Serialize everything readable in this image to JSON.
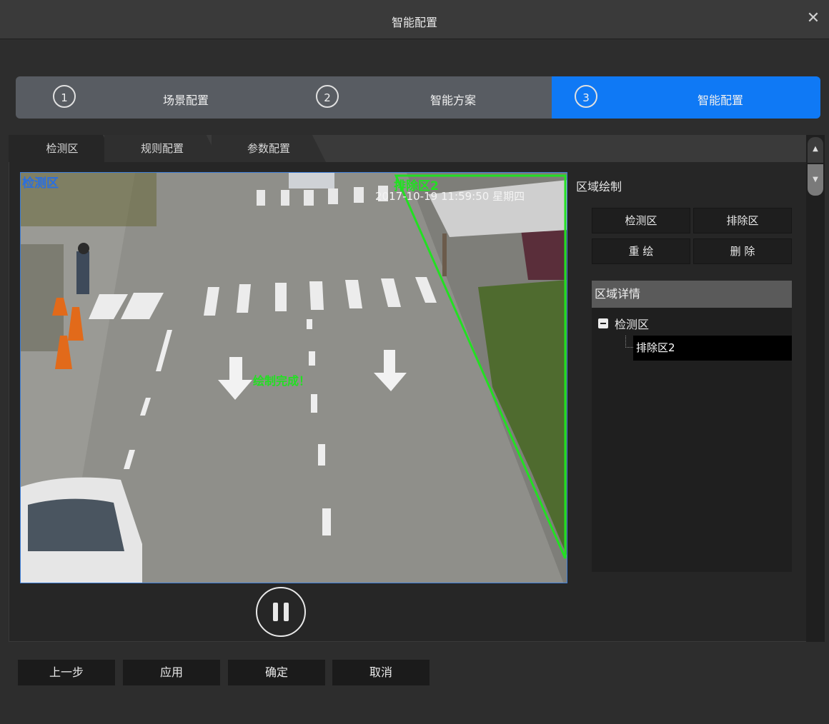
{
  "window": {
    "title": "智能配置",
    "close_symbol": "✕"
  },
  "steps": [
    {
      "num": "1",
      "label": "场景配置"
    },
    {
      "num": "2",
      "label": "智能方案"
    },
    {
      "num": "3",
      "label": "智能配置",
      "active": true
    }
  ],
  "tabs": [
    "检测区",
    "规则配置",
    "参数配置"
  ],
  "video": {
    "overlay_detect_label": "检测区",
    "overlay_exclude_label": "排除区2",
    "timestamp": "2017-10-19 11:59:50 星期四",
    "status": "绘制完成！",
    "colors": {
      "detect": "#3f7fd8",
      "exclude": "#22e022"
    }
  },
  "draw": {
    "title": "区域绘制",
    "buttons": {
      "detect": "检测区",
      "exclude": "排除区",
      "redraw": "重 绘",
      "delete": "删 除"
    }
  },
  "details": {
    "title": "区域详情",
    "root": "检测区",
    "child": "排除区2"
  },
  "footer": {
    "prev": "上一步",
    "apply": "应用",
    "ok": "确定",
    "cancel": "取消"
  },
  "colors": {
    "accent": "#0f79f5"
  }
}
